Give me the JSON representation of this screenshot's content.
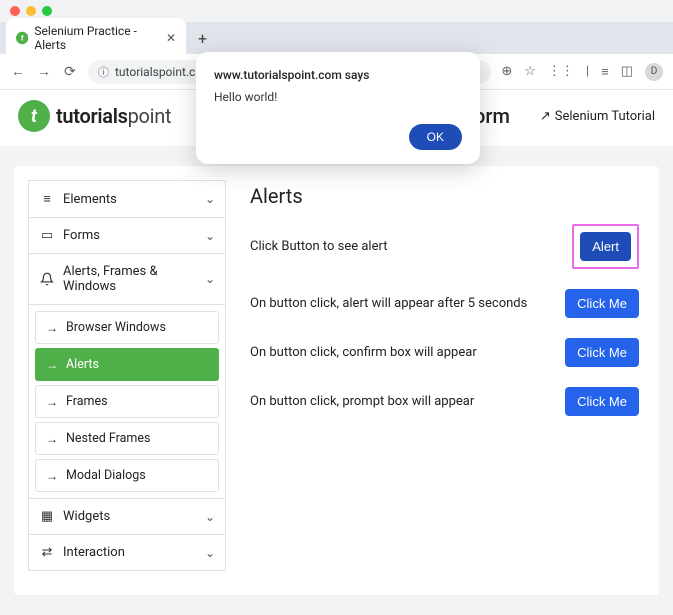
{
  "browser": {
    "tab_title": "Selenium Practice - Alerts",
    "url": "tutorialspoint.com/selenium/practice/alerts.php",
    "newtab": "+"
  },
  "dialog": {
    "says": "www.tutorialspoint.com says",
    "message": "Hello world!",
    "ok": "OK"
  },
  "header": {
    "brand1": "tutorials",
    "brand2": "point",
    "partial": "orm",
    "link": "Selenium Tutorial"
  },
  "sidebar": {
    "acc": [
      {
        "icon": "≡",
        "label": "Elements"
      },
      {
        "icon": "▭",
        "label": "Forms"
      },
      {
        "icon": "🔔",
        "label": "Alerts, Frames & Windows"
      },
      {
        "icon": "▦",
        "label": "Widgets"
      },
      {
        "icon": "⇄",
        "label": "Interaction"
      }
    ],
    "sub": [
      "Browser Windows",
      "Alerts",
      "Frames",
      "Nested Frames",
      "Modal Dialogs"
    ]
  },
  "main": {
    "title": "Alerts",
    "rows": [
      {
        "text": "Click Button to see alert",
        "btn": "Alert",
        "highlighted": true
      },
      {
        "text": "On button click, alert will appear after 5 seconds",
        "btn": "Click Me"
      },
      {
        "text": "On button click, confirm box will appear",
        "btn": "Click Me"
      },
      {
        "text": "On button click, prompt box will appear",
        "btn": "Click Me"
      }
    ]
  }
}
